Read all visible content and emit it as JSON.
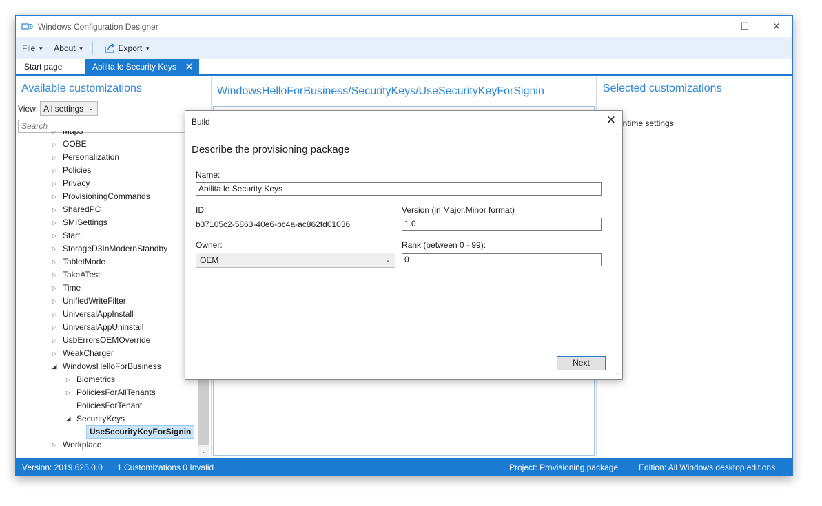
{
  "window": {
    "title": "Windows Configuration Designer",
    "icon": "designer-app-icon",
    "controls": {
      "minimize": "—",
      "maximize": "☐",
      "close": "✕"
    }
  },
  "menu": {
    "file": "File",
    "about": "About",
    "export": "Export"
  },
  "tabs": {
    "start": "Start page",
    "active": "Abilita le Security Keys",
    "close": "✕"
  },
  "left_panel": {
    "heading": "Available customizations",
    "view_label": "View:",
    "view_value": "All settings",
    "search_placeholder": "Search",
    "tree": [
      {
        "label": "Maps",
        "state": "collapsed",
        "level": 0
      },
      {
        "label": "OOBE",
        "state": "collapsed",
        "level": 0
      },
      {
        "label": "Personalization",
        "state": "collapsed",
        "level": 0
      },
      {
        "label": "Policies",
        "state": "collapsed",
        "level": 0
      },
      {
        "label": "Privacy",
        "state": "collapsed",
        "level": 0
      },
      {
        "label": "ProvisioningCommands",
        "state": "collapsed",
        "level": 0
      },
      {
        "label": "SharedPC",
        "state": "collapsed",
        "level": 0
      },
      {
        "label": "SMISettings",
        "state": "collapsed",
        "level": 0
      },
      {
        "label": "Start",
        "state": "collapsed",
        "level": 0
      },
      {
        "label": "StorageD3InModernStandby",
        "state": "collapsed",
        "level": 0
      },
      {
        "label": "TabletMode",
        "state": "collapsed",
        "level": 0
      },
      {
        "label": "TakeATest",
        "state": "collapsed",
        "level": 0
      },
      {
        "label": "Time",
        "state": "collapsed",
        "level": 0
      },
      {
        "label": "UnifiedWriteFilter",
        "state": "collapsed",
        "level": 0
      },
      {
        "label": "UniversalAppInstall",
        "state": "collapsed",
        "level": 0
      },
      {
        "label": "UniversalAppUninstall",
        "state": "collapsed",
        "level": 0
      },
      {
        "label": "UsbErrorsOEMOverride",
        "state": "collapsed",
        "level": 0
      },
      {
        "label": "WeakCharger",
        "state": "collapsed",
        "level": 0
      },
      {
        "label": "WindowsHelloForBusiness",
        "state": "expanded",
        "level": 0
      },
      {
        "label": "Biometrics",
        "state": "collapsed",
        "level": 1
      },
      {
        "label": "PoliciesForAllTenants",
        "state": "collapsed",
        "level": 1
      },
      {
        "label": "PoliciesForTenant",
        "state": "leaf",
        "level": 1
      },
      {
        "label": "SecurityKeys",
        "state": "expanded",
        "level": 1
      },
      {
        "label": "UseSecurityKeyForSignin",
        "state": "selected",
        "level": 2
      },
      {
        "label": "Workplace",
        "state": "collapsed",
        "level": 0
      }
    ]
  },
  "middle_panel": {
    "heading": "WindowsHelloForBusiness/SecurityKeys/UseSecurityKeyForSignin"
  },
  "right_panel": {
    "heading": "Selected customizations",
    "runtime_label": "untime settings"
  },
  "status": {
    "version": "Version: 2019.625.0.0",
    "customizations": "1 Customizations 0 Invalid",
    "project": "Project: Provisioning package",
    "edition": "Edition: All Windows desktop editions"
  },
  "dialog": {
    "title": "Build",
    "heading": "Describe the provisioning package",
    "name_label": "Name:",
    "name_value": "Abilita le Security Keys",
    "id_label": "ID:",
    "id_value": "b37105c2-5863-40e6-bc4a-ac862fd01036",
    "version_label": "Version (in Major.Minor format)",
    "version_value": "1.0",
    "owner_label": "Owner:",
    "owner_value": "OEM",
    "rank_label": "Rank (between 0 - 99):",
    "rank_value": "0",
    "next_button": "Next"
  },
  "colors": {
    "accent": "#1b7ad2",
    "heading_blue": "#2b86d6",
    "menubar_bg": "#e6f0fb",
    "tree_selected_bg": "#cce4f7"
  }
}
